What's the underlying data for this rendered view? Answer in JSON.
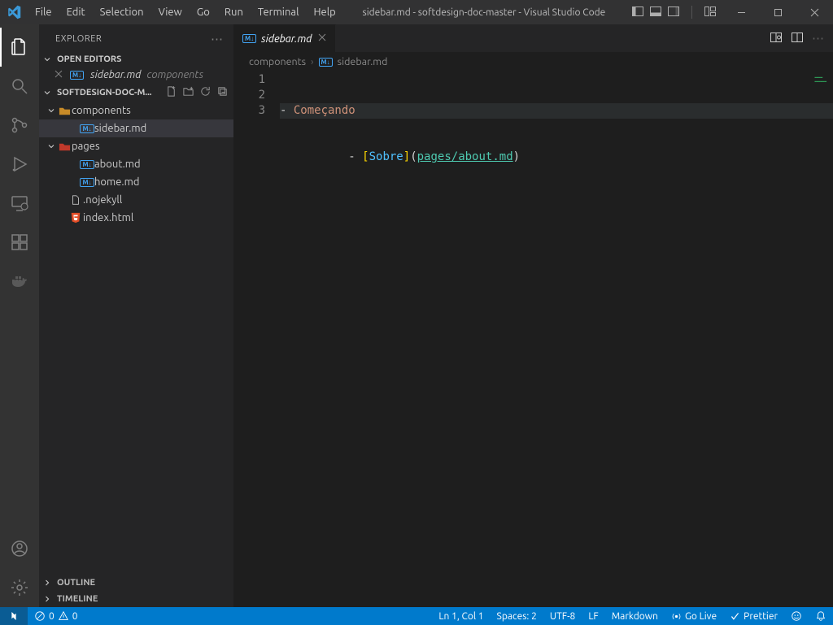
{
  "window": {
    "title": "sidebar.md - softdesign-doc-master - Visual Studio Code"
  },
  "menu": [
    "File",
    "Edit",
    "Selection",
    "View",
    "Go",
    "Run",
    "Terminal",
    "Help"
  ],
  "explorer": {
    "title": "EXPLORER",
    "open_editors_label": "OPEN EDITORS",
    "open_editors": [
      {
        "name": "sidebar.md",
        "hint": "components"
      }
    ],
    "repo_label": "SOFTDESIGN-DOC-M...",
    "tree": {
      "a_folder": "components",
      "a_file": "sidebar.md",
      "b_folder": "pages",
      "b_file1": "about.md",
      "b_file2": "home.md",
      "root_file1": ".nojekyll",
      "root_file2": "index.html"
    },
    "outline_label": "OUTLINE",
    "timeline_label": "TIMELINE"
  },
  "tab": {
    "name": "sidebar.md"
  },
  "breadcrumbs": {
    "folder": "components",
    "file": "sidebar.md"
  },
  "editor": {
    "lines": [
      "1",
      "2",
      "3"
    ],
    "line1_prefix": "- ",
    "line1_text": "Começando",
    "line3_prefix": "  - ",
    "link_text": "Sobre",
    "link_url": "pages/about.md"
  },
  "status": {
    "errors": "0",
    "warnings": "0",
    "ln_col": "Ln 1, Col 1",
    "spaces": "Spaces: 2",
    "encoding": "UTF-8",
    "eol": "LF",
    "lang": "Markdown",
    "golive": "Go Live",
    "prettier": "Prettier"
  }
}
